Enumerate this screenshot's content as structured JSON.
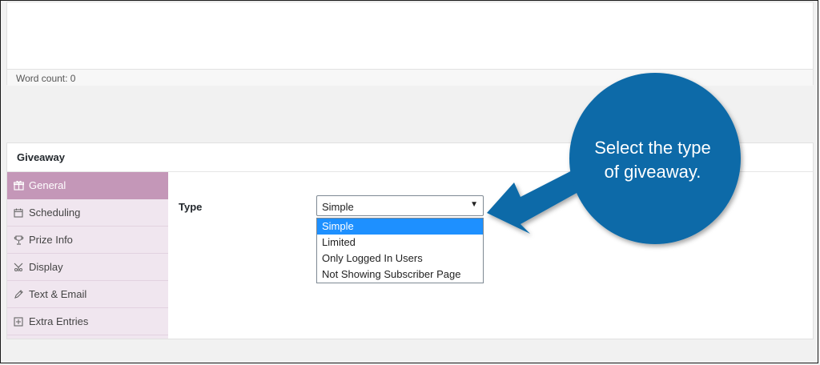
{
  "editor": {
    "word_count": "Word count: 0"
  },
  "metabox": {
    "title": "Giveaway",
    "tabs": [
      {
        "label": "General",
        "icon": "gift-icon",
        "active": true
      },
      {
        "label": "Scheduling",
        "icon": "calendar-icon"
      },
      {
        "label": "Prize Info",
        "icon": "trophy-icon"
      },
      {
        "label": "Display",
        "icon": "display-icon"
      },
      {
        "label": "Text & Email",
        "icon": "pencil-icon"
      },
      {
        "label": "Extra Entries",
        "icon": "plus-square-icon"
      }
    ],
    "type_label": "Type",
    "type_select": {
      "value": "Simple",
      "options": [
        "Simple",
        "Limited",
        "Only Logged In Users",
        "Not Showing Subscriber Page"
      ]
    }
  },
  "callout": {
    "line1": "Select the type",
    "line2": "of giveaway.",
    "color": "#0b6aa8"
  },
  "colors": {
    "tab_active": "#c497b8",
    "tab_bg": "#f0e6ef",
    "option_highlight": "#1e90ff"
  }
}
